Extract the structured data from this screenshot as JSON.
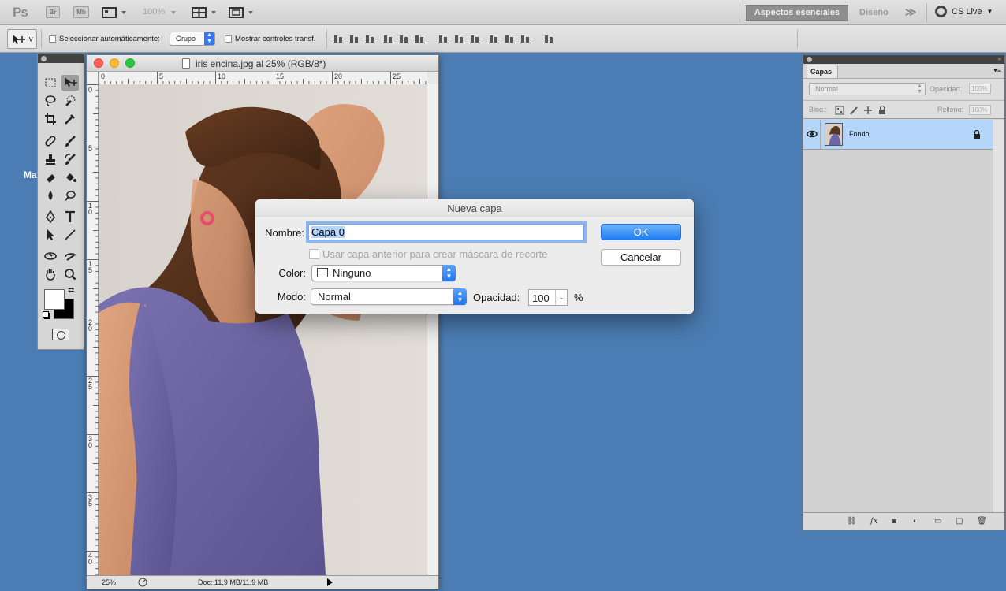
{
  "appbar": {
    "logo": "Ps",
    "bridge_label": "Br",
    "minibridge_label": "Mb",
    "zoom": "100%",
    "workspace_active": "Aspectos esenciales",
    "workspace_design": "Diseño",
    "more": "≫",
    "cslive": "CS Live"
  },
  "options": {
    "tool_suffix": "v",
    "auto_select_label": "Seleccionar automáticamente:",
    "auto_select_value": "Grupo",
    "show_transform_label": "Mostrar controles transf."
  },
  "background_label": "Ma",
  "document": {
    "title": "iris encina.jpg al 25% (RGB/8*)",
    "ruler_top": [
      "0",
      "5",
      "10",
      "15",
      "20",
      "25"
    ],
    "ruler_left": [
      "0",
      "5",
      "1 0",
      "1 5",
      "2 0",
      "2 5",
      "3 0",
      "3 5",
      "4 0"
    ],
    "status_zoom": "25%",
    "status_doc": "Doc: 11,9 MB/11,9 MB"
  },
  "layers_panel": {
    "tab": "Capas",
    "blend_mode": "Normal",
    "opacity_label": "Opacidad:",
    "opacity_value": "100%",
    "lock_label": "Bloq.:",
    "fill_label": "Relleno:",
    "fill_value": "100%",
    "layers": [
      {
        "name": "Fondo",
        "visible": true,
        "locked": true
      }
    ]
  },
  "dialog": {
    "title": "Nueva capa",
    "name_label": "Nombre:",
    "name_value": "Capa 0",
    "clip_mask_label": "Usar capa anterior para crear máscara de recorte",
    "color_label": "Color:",
    "color_value": "Ninguno",
    "mode_label": "Modo:",
    "mode_value": "Normal",
    "opacity_label": "Opacidad:",
    "opacity_value": "100",
    "opacity_unit": "%",
    "ok_label": "OK",
    "cancel_label": "Cancelar"
  },
  "colors": {
    "desktop": "#4b7db4",
    "selection": "#b5d6fb",
    "accent_blue": "#1f7df2"
  }
}
